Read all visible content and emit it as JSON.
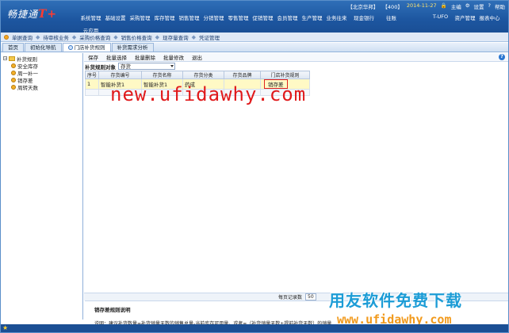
{
  "app": {
    "logo_text": "畅捷通",
    "logo_plus": "T+"
  },
  "status": {
    "company": "【北京华邦】",
    "account": "【400】",
    "date": "2014-11-27",
    "user": "主编",
    "settings": "设置",
    "help": "帮助"
  },
  "menu": [
    "系统管理",
    "基础设置",
    "采购管理",
    "库存管理",
    "销售管理",
    "分销管理",
    "零售管理",
    "促销管理",
    "会员管理",
    "生产管理",
    "业务往来",
    "现金银行",
    "往账",
    "",
    "T-UFO",
    "资产管理",
    "报表中心",
    "云应用"
  ],
  "quickbar": [
    "单据查询",
    "待审核业务",
    "采购价格查询",
    "销售价格查询",
    "现存量查询",
    "凭证管理"
  ],
  "tabs": [
    "首页",
    "初始化导航",
    "门店补货规则",
    "补货需求分析"
  ],
  "tree": {
    "root": "补货规则",
    "children": [
      "安全库存",
      "周一补一",
      "销存差",
      "周转天数"
    ]
  },
  "toolbar": [
    "保存",
    "批量选择",
    "批量删除",
    "批量修改",
    "退出"
  ],
  "filter": {
    "label": "补货规则对象",
    "value": "存货"
  },
  "grid": {
    "headers": [
      "序号",
      "存货编号",
      "存货名称",
      "存货分类",
      "存货品牌",
      "门店补货规则"
    ],
    "rows": [
      {
        "no": "1",
        "code": "智能补货1",
        "name": "智能补货1",
        "category": "药成",
        "brand": "",
        "rule": "销存差"
      },
      {
        "no": "",
        "code": "",
        "name": "",
        "category": "",
        "brand": "",
        "rule": ""
      }
    ]
  },
  "watermark": "new.ufidawhy.com",
  "pager": {
    "label": "每页记录数",
    "value": "50"
  },
  "description": {
    "title": "销存差规则说明",
    "text": "说明：建议补货数量=补货销量天数的销售总量-当前库存可用量，或者=（补货销量天数+提前补货天数）的销量"
  },
  "brand": {
    "cn": "用友软件免费下载",
    "url": "www.ufidawhy.com"
  }
}
